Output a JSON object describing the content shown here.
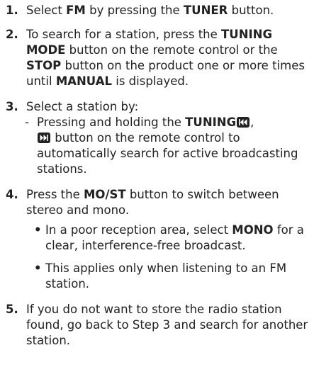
{
  "steps": [
    {
      "num": "1.",
      "t1": "Select ",
      "b1": "FM",
      "t2": " by pressing the ",
      "b2": "TUNER",
      "t3": " button."
    },
    {
      "num": "2.",
      "t1": "To search for a station, press the ",
      "b1": "TUNING MODE",
      "t2": " button on the remote control or the ",
      "b2": "STOP",
      "t3": " button on the product one or more times until ",
      "b3": "MANUAL",
      "t4": " is displayed."
    },
    {
      "num": "3.",
      "t1": "Select a station by:",
      "dash": "-",
      "d1": "Pressing and holding the ",
      "db1": "TUNING",
      "d2": ",",
      "d3": " button on the remote control to automatically search for active broadcasting stations."
    },
    {
      "num": "4.",
      "t1": "Press the ",
      "b1": "MO/ST",
      "t2": " button to switch between stereo and mono.",
      "bullets": [
        {
          "t1": "In a poor reception area, select ",
          "b1": "MONO",
          "t2": " for a clear, interference-free broadcast."
        },
        {
          "t1": "This applies only when listening to an FM station."
        }
      ]
    },
    {
      "num": "5.",
      "t1": "If you do not want to store the radio station found, go back to Step 3 and search for another station."
    }
  ],
  "bullet_char": "•",
  "icons": [
    "rewind-icon",
    "fast-forward-icon"
  ]
}
